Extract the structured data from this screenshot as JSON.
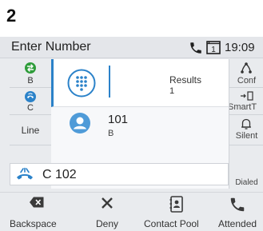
{
  "step_number": "2",
  "title_bar": {
    "title": "Enter Number",
    "line_badge": "1",
    "time": "19:09"
  },
  "left_keys": [
    {
      "label": "B",
      "icon": "transfer-circle-icon",
      "color": "#2e9c3a"
    },
    {
      "label": "C",
      "icon": "phone-hold-circle-icon",
      "color": "#2b82c9"
    },
    {
      "label": "Line",
      "icon": ""
    }
  ],
  "results": {
    "label": "Results",
    "count": "1"
  },
  "contact": {
    "number": "101",
    "name": "B"
  },
  "right_keys": [
    {
      "label": "Conf",
      "icon": "conference-icon"
    },
    {
      "label": "SmartT",
      "icon": "smart-transfer-icon"
    },
    {
      "label": "Silent",
      "icon": "bell-icon"
    },
    {
      "label": "Dialed",
      "icon": ""
    }
  ],
  "entry": {
    "text": "C 102",
    "icon": "outgoing-call-icon"
  },
  "softkeys": [
    {
      "label": "Backspace",
      "icon": "backspace-icon"
    },
    {
      "label": "Deny",
      "icon": "close-icon"
    },
    {
      "label": "Contact Pool",
      "icon": "contact-card-icon"
    },
    {
      "label": "Attended",
      "icon": "phone-handset-icon"
    }
  ],
  "colors": {
    "accent": "#2b82c9",
    "green": "#2e9c3a",
    "panel": "#e9ebee"
  }
}
